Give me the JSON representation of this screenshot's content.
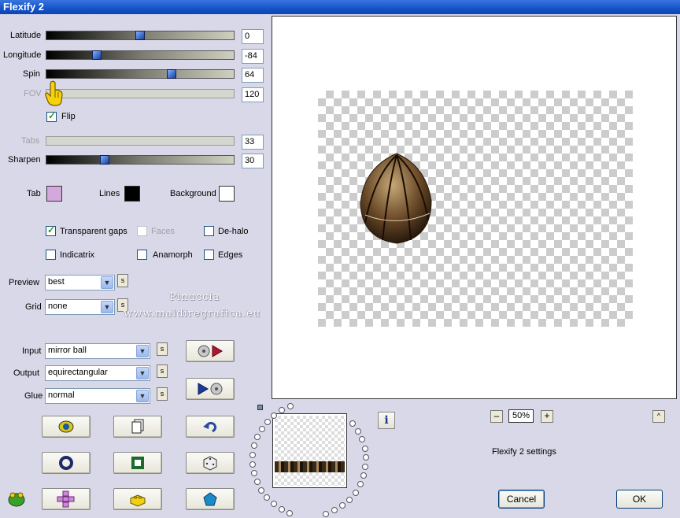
{
  "window": {
    "title": "Flexify 2"
  },
  "sliders": {
    "latitude": {
      "label": "Latitude",
      "value": "0",
      "level": 0.5
    },
    "longitude": {
      "label": "Longitude",
      "value": "-84",
      "level": 0.27
    },
    "spin": {
      "label": "Spin",
      "value": "64",
      "level": 0.67
    },
    "fov": {
      "label": "FOV",
      "value": "120",
      "level": 0.04
    },
    "tabs": {
      "label": "Tabs",
      "value": "33"
    },
    "sharpen": {
      "label": "Sharpen",
      "value": "30",
      "level": 0.31
    }
  },
  "flip": {
    "label": "Flip",
    "checked": true
  },
  "colors": {
    "tab": {
      "label": "Tab",
      "color": "#d4a8dc"
    },
    "lines": {
      "label": "Lines",
      "color": "#000000"
    },
    "background": {
      "label": "Background",
      "color": "#ffffff"
    }
  },
  "options": {
    "transparent_gaps": {
      "label": "Transparent gaps",
      "checked": true
    },
    "faces": {
      "label": "Faces",
      "checked": false
    },
    "de_halo": {
      "label": "De-halo",
      "checked": false
    },
    "indicatrix": {
      "label": "Indicatrix",
      "checked": false
    },
    "anamorph": {
      "label": "Anamorph",
      "checked": false
    },
    "edges": {
      "label": "Edges",
      "checked": false
    }
  },
  "selects": {
    "preview": {
      "label": "Preview",
      "value": "best"
    },
    "grid": {
      "label": "Grid",
      "value": "none"
    },
    "input": {
      "label": "Input",
      "value": "mirror ball"
    },
    "output": {
      "label": "Output",
      "value": "equirectangular"
    },
    "glue": {
      "label": "Glue",
      "value": "normal"
    }
  },
  "s_label": "s",
  "watermark": {
    "line1": "Pinuccia",
    "line2": "www.maldiregrafica.eu"
  },
  "zoom": {
    "minus": "–",
    "value": "50%",
    "plus": "+",
    "collapse": "^"
  },
  "info_label": "i",
  "settings_name": "Flexify 2 settings",
  "buttons": {
    "cancel": "Cancel",
    "ok": "OK"
  }
}
